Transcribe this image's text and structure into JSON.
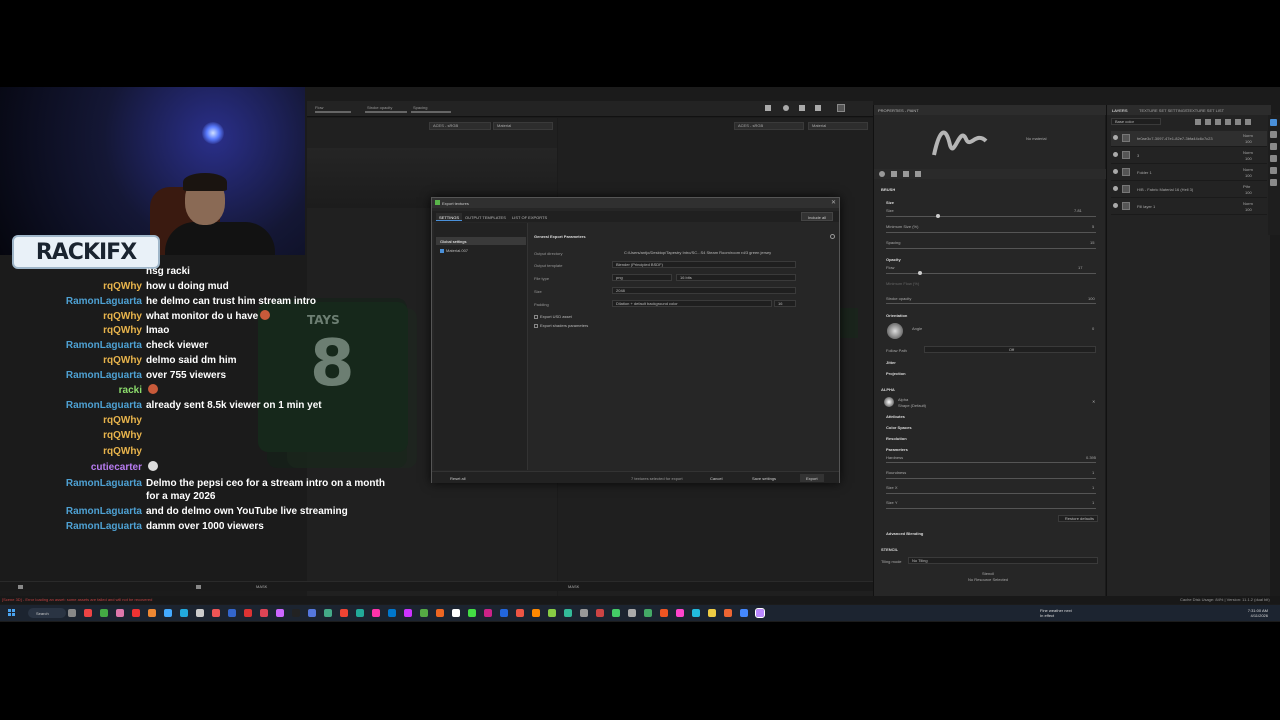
{
  "stream": {
    "logo_text": "RACKIFX"
  },
  "chat": [
    {
      "user": "",
      "msg": "nsg racki",
      "user_class": "u-rq"
    },
    {
      "user": "rqQWhy",
      "msg": "how u doing mud",
      "user_class": "u-rq"
    },
    {
      "user": "RamonLaguarta",
      "msg": "he delmo can trust him stream intro",
      "user_class": "u-ramon"
    },
    {
      "user": "rqQWhy",
      "msg": "what monitor do u have",
      "user_class": "u-rq",
      "emote": true
    },
    {
      "user": "rqQWhy",
      "msg": "lmao",
      "user_class": "u-rq"
    },
    {
      "user": "RamonLaguarta",
      "msg": "check viewer",
      "user_class": "u-ramon"
    },
    {
      "user": "rqQWhy",
      "msg": "delmo said dm him",
      "user_class": "u-rq"
    },
    {
      "user": "RamonLaguarta",
      "msg": "over 755 viewers",
      "user_class": "u-ramon"
    },
    {
      "user": "racki",
      "msg": "",
      "user_class": "u-racki",
      "emote": true
    },
    {
      "user": "RamonLaguarta",
      "msg": "already sent 8.5k viewer on 1 min yet",
      "user_class": "u-ramon"
    },
    {
      "user": "rqQWhy",
      "msg": "",
      "user_class": "u-rq"
    },
    {
      "user": "rqQWhy",
      "msg": "",
      "user_class": "u-rq"
    },
    {
      "user": "rqQWhy",
      "msg": "",
      "user_class": "u-rq"
    },
    {
      "user": "cutiecarter",
      "msg": "",
      "user_class": "u-cutie",
      "emote": true,
      "ghost": true
    },
    {
      "user": "RamonLaguarta",
      "msg": "Delmo the pepsi ceo for a stream intro on a month for a may 2026",
      "user_class": "u-ramon"
    },
    {
      "user": "RamonLaguarta",
      "msg": "and do delmo own YouTube live streaming",
      "user_class": "u-ramon"
    },
    {
      "user": "RamonLaguarta",
      "msg": "damm over 1000 viewers",
      "user_class": "u-ramon"
    }
  ],
  "viewport": {
    "flow_label": "Flow",
    "stroke_opacity_label": "Stroke opacity",
    "spacing_label": "Spacing",
    "colorspace_left": "ACES - sRGB",
    "channel_left": "Material",
    "colorspace_right": "ACES - sRGB",
    "channel_right": "Material",
    "jersey_text": "TAYS",
    "jersey_number": "8",
    "mask_label_left": "MASK",
    "mask_label_right": "MASK"
  },
  "properties": {
    "header": "PROPERTIES - PAINT",
    "no_material": "No material",
    "brush_title": "BRUSH",
    "size_label": "Size",
    "size_value": "7.81",
    "min_size_label": "Minimum Size (%)",
    "min_size_value": "5",
    "spacing_label": "Spacing",
    "spacing_value": "15",
    "opacity_section": "Opacity",
    "flow_label": "Flow",
    "flow_value": "17",
    "min_flow_label": "Minimum Flow (%)",
    "stroke_opacity_label": "Stroke opacity",
    "stroke_opacity_value": "100",
    "orientation_section": "Orientation",
    "angle_label": "Angle",
    "angle_value": "0",
    "follow_path_label": "Follow Path",
    "follow_path_value": "Off",
    "jitter_section": "Jitter",
    "projection_section": "Projection",
    "alpha_title": "ALPHA",
    "alpha_name": "Alpha",
    "alpha_shape": "Shape (Default)",
    "attributes_section": "Attributes",
    "color_spaces_section": "Color Spaces",
    "resolution_section": "Resolution",
    "parameters_section": "Parameters",
    "hardness_label": "Hardness",
    "hardness_value": "0.395",
    "roundness_label": "Roundness",
    "roundness_value": "1",
    "size_x_label": "Size X",
    "size_x_value": "1",
    "size_y_label": "Size Y",
    "size_y_value": "1",
    "restore_defaults": "Restore defaults",
    "advanced_blending": "Advanced Blending",
    "stencil_title": "STENCIL",
    "tiling_mode_label": "Tiling mode",
    "tiling_mode_value": "No Tiling",
    "stencil_label": "Stencil",
    "no_resource": "No Resource Selected"
  },
  "layers": {
    "tab1": "LAYERS",
    "tab2": "TEXTURE SET SETTINGS",
    "tab3": "TEXTURE SET LIST",
    "base_color": "Base color",
    "rows": [
      {
        "name": "fe0ae3c7-3097-47e1-82e7-3bfa44c6c7c23",
        "blend": "Norm",
        "opacity": "100"
      },
      {
        "name": "3",
        "blend": "Norm",
        "opacity": "100"
      },
      {
        "name": "Folder 1",
        "blend": "Norm",
        "opacity": "100"
      },
      {
        "name": "H/B - Fabric Material 16 (Hell 3)",
        "blend": "Pthr",
        "opacity": "100"
      },
      {
        "name": "Fill layer 1",
        "blend": "Norm",
        "opacity": "100"
      }
    ]
  },
  "dialog": {
    "title": "Export textures",
    "tab_settings": "SETTINGS",
    "tab_output": "OUTPUT TEMPLATES",
    "tab_list": "LIST OF EXPORTS",
    "include_all": "Include all",
    "global_settings": "Global settings",
    "material_item": "Material.007",
    "section_title": "General Export Parameters",
    "output_dir_label": "Output directory",
    "output_dir_value": "C:/Users/antjo/Desktop/Tapestry Intro/SC...S4 Steam Room/room rd/3 green jersey",
    "output_template_label": "Output template",
    "output_template_value": "Blender (Principled BSDF)",
    "file_type_label": "File type",
    "file_type_value": "png",
    "bit_depth_value": "16 bits",
    "size_label": "Size",
    "size_value": "2048",
    "padding_label": "Padding",
    "padding_value": "Dilation + default background color",
    "padding_amount": "16",
    "export_usd_label": "Export USD asset",
    "export_shaders_label": "Export shaders parameters",
    "reset_all": "Reset all",
    "textures_selected": "7 textures selected for export",
    "cancel": "Cancel",
    "save_settings": "Save settings",
    "export": "Export"
  },
  "status": {
    "warning": "[Scene 3D] - Error loading an asset: some assets are failed and will not be recovered",
    "cache": "Cache Disk Usage: 84% | Version: 11.1.2 (dual bit)"
  },
  "taskbar": {
    "search": "Search",
    "weather_line1": "Fine weather next",
    "weather_line2": "In effect",
    "time": "7:31:00 AM",
    "date": "4/11/2026"
  }
}
